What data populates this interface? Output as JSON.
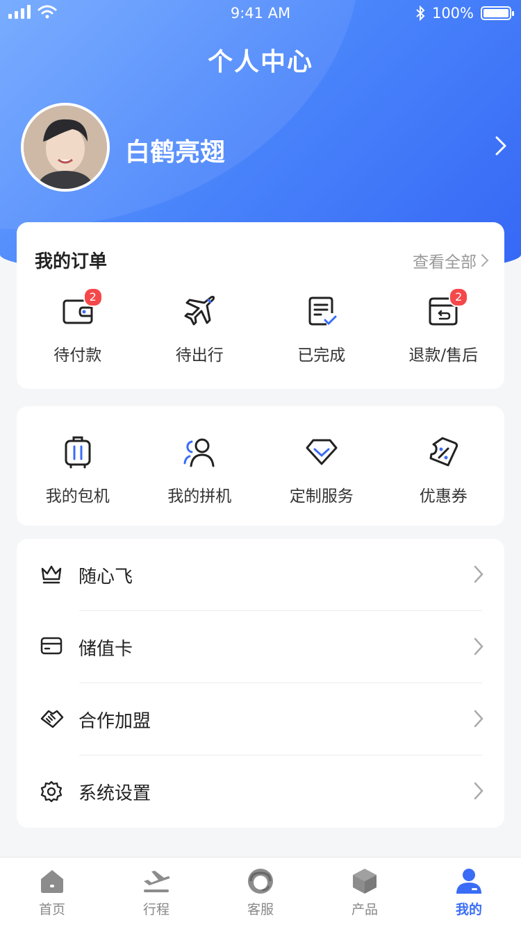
{
  "status_bar": {
    "time": "9:41 AM",
    "battery": "100%"
  },
  "header": {
    "title": "个人中心"
  },
  "profile": {
    "name": "白鹤亮翅"
  },
  "orders": {
    "title": "我的订单",
    "view_all": "查看全部",
    "items": [
      {
        "label": "待付款",
        "icon": "wallet-icon",
        "badge": "2"
      },
      {
        "label": "待出行",
        "icon": "airplane-icon"
      },
      {
        "label": "已完成",
        "icon": "checklist-icon"
      },
      {
        "label": "退款/售后",
        "icon": "refund-box-icon",
        "badge": "2"
      }
    ]
  },
  "services": {
    "items": [
      {
        "label": "我的包机",
        "icon": "luggage-icon"
      },
      {
        "label": "我的拼机",
        "icon": "group-icon"
      },
      {
        "label": "定制服务",
        "icon": "diamond-icon"
      },
      {
        "label": "优惠券",
        "icon": "coupon-icon"
      }
    ]
  },
  "menu": {
    "items": [
      {
        "label": "随心飞",
        "icon": "crown-icon"
      },
      {
        "label": "储值卡",
        "icon": "card-icon"
      },
      {
        "label": "合作加盟",
        "icon": "handshake-icon"
      },
      {
        "label": "系统设置",
        "icon": "settings-icon"
      }
    ]
  },
  "tabbar": {
    "items": [
      {
        "label": "首页",
        "icon": "home-icon"
      },
      {
        "label": "行程",
        "icon": "departure-icon"
      },
      {
        "label": "客服",
        "icon": "support-icon"
      },
      {
        "label": "产品",
        "icon": "product-icon"
      },
      {
        "label": "我的",
        "icon": "user-icon",
        "active": true
      }
    ]
  },
  "colors": {
    "accent": "#3a6cf6",
    "badge": "#f5484a",
    "hero_start": "#6ea6ff",
    "hero_end": "#3567f5"
  }
}
